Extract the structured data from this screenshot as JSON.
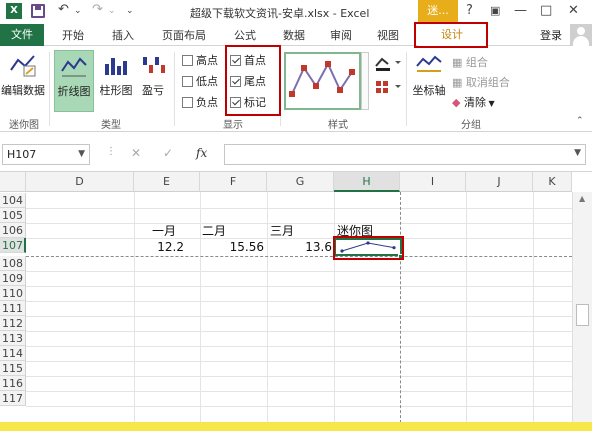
{
  "window": {
    "title": "超级下载软文资讯-安卓.xlsx - Excel",
    "context_tab_label": "迷...",
    "help": "?",
    "minimize": "—",
    "maximize": "□",
    "close": "✕",
    "qat_undo": "↶",
    "qat_redo": "↷",
    "qat_more": "⌄"
  },
  "tabs": {
    "file": "文件",
    "items": [
      "开始",
      "插入",
      "页面布局",
      "公式",
      "数据",
      "审阅",
      "视图"
    ],
    "design": "设计",
    "login": "登录"
  },
  "ribbon": {
    "minichart": {
      "edit_data": "编辑数据",
      "label": "迷你图"
    },
    "type": {
      "line": "折线图",
      "column": "柱形图",
      "winloss": "盈亏",
      "label": "类型"
    },
    "show": {
      "high": "高点",
      "low": "低点",
      "negative": "负点",
      "first": "首点",
      "last": "尾点",
      "marker": "标记",
      "label": "显示",
      "checked": {
        "high": false,
        "low": false,
        "negative": false,
        "first": true,
        "last": true,
        "marker": true
      }
    },
    "style": {
      "label": "样式"
    },
    "group": {
      "axis": "坐标轴",
      "group_btn": "组合",
      "ungroup_btn": "取消组合",
      "clear_btn": "清除",
      "label": "分组"
    }
  },
  "formula_bar": {
    "name_box": "H107",
    "cancel": "✕",
    "enter": "✓",
    "fx": "fx",
    "value": ""
  },
  "grid": {
    "columns": [
      "D",
      "E",
      "F",
      "G",
      "H",
      "I",
      "J",
      "K"
    ],
    "rows": [
      "104",
      "105",
      "106",
      "107",
      "108",
      "109",
      "110",
      "111",
      "112",
      "113",
      "114",
      "115",
      "116",
      "117"
    ],
    "active_column": "H",
    "active_row": "107",
    "headers_row106": {
      "e": "一月",
      "f": "二月",
      "g": "三月",
      "h": "迷你图"
    },
    "values_row107": {
      "e": "12.2",
      "f": "15.56",
      "g": "13.6"
    }
  },
  "sparkline_values": [
    12.2,
    15.56,
    13.6
  ],
  "colors": {
    "accent": "#217346",
    "design_tab": "#c5830a",
    "highlight": "#c00000",
    "sparkline": "#2b3a8f"
  }
}
